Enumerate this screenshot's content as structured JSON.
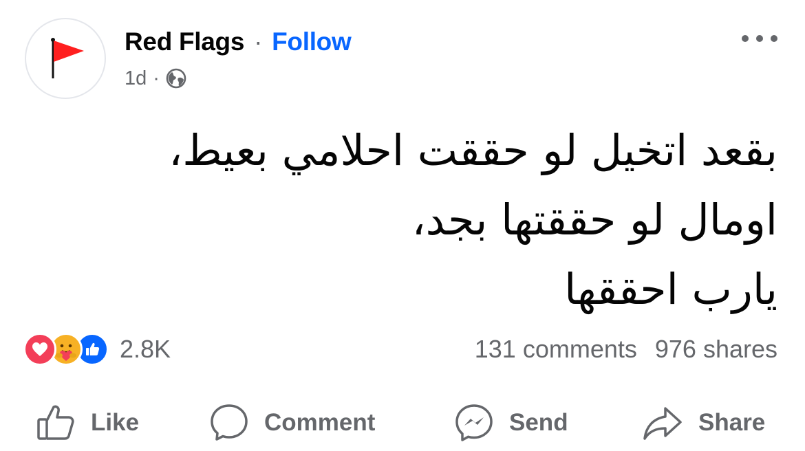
{
  "post": {
    "page_name": "Red Flags",
    "separator": "·",
    "follow_label": "Follow",
    "time_ago": "1d",
    "meta_separator": "·",
    "audience_icon": "globe-icon",
    "more_icon": "more-dots-icon",
    "avatar_icon": "red-flag-icon",
    "text_lines": [
      "بقعد اتخيل لو حققت احلامي بعيط،",
      "اومال لو حققتها بجد،",
      "يارب احققها"
    ]
  },
  "stats": {
    "reaction_icons": [
      "love-icon",
      "care-icon",
      "like-icon"
    ],
    "reaction_count": "2.8K",
    "comments": "131 comments",
    "shares": "976 shares"
  },
  "actions": [
    {
      "label": "Like",
      "icon": "thumbs-up-icon"
    },
    {
      "label": "Comment",
      "icon": "comment-bubble-icon"
    },
    {
      "label": "Send",
      "icon": "messenger-icon"
    },
    {
      "label": "Share",
      "icon": "share-arrow-icon"
    }
  ],
  "colors": {
    "follow": "#0866ff",
    "secondary_text": "#65676b",
    "flag": "#ff1f1f",
    "love": "#f33e58",
    "care": "#f7b125",
    "like": "#0866ff"
  }
}
